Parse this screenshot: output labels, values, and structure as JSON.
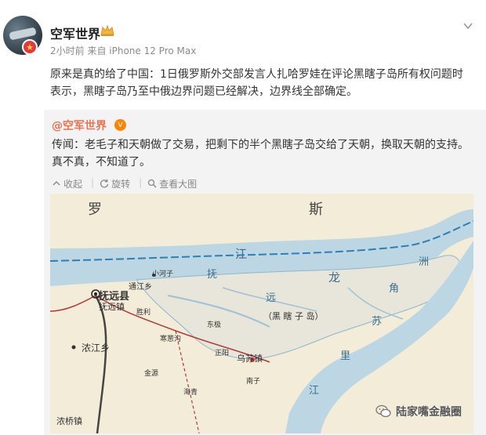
{
  "post": {
    "user_name": "空军世界",
    "meta": "2小时前  来自 iPhone 12 Pro Max",
    "body": "原来是真的给了中国：1日俄罗斯外交部发言人扎哈罗娃在评论黑瞎子岛所有权问题时表示，黑瞎子岛乃至中俄边界问题已经解决，边界线全部确定。"
  },
  "retweet": {
    "author": "@空军世界",
    "text": "传闻：老毛子和天朝做了交易，把剩下的半个黑瞎子岛交给了天朝，换取天朝的支持。真不真，不知道了。",
    "actions": {
      "collapse": "收起",
      "rotate": "旋转",
      "view_large": "查看大图"
    }
  },
  "map": {
    "labels": {
      "luo": "罗",
      "si": "斯",
      "fuyuan_county": "抚远县",
      "fuyuan_town": "抚远镇",
      "nongjiang": "浓江乡",
      "wusu_town": "乌苏镇",
      "heixiazi": "（黑 瞎 子 岛）",
      "fu": "抚",
      "yuan": "远",
      "long": "龙",
      "jiang": "江",
      "zhou": "洲",
      "jiao": "角",
      "su": "苏",
      "li": "里",
      "jiang2": "江",
      "tongjiang": "通江乡",
      "dongji": "东极",
      "shengli": "胜利",
      "hanjia": "寒葱沟",
      "xiaohezi": "小河子",
      "jinyuan": "金源",
      "zhengyang": "正阳",
      "haiqing": "海青",
      "nanzi": "南子",
      "nonghe": "浓桥镇"
    },
    "watermark": "陆家嘴金融圈"
  }
}
